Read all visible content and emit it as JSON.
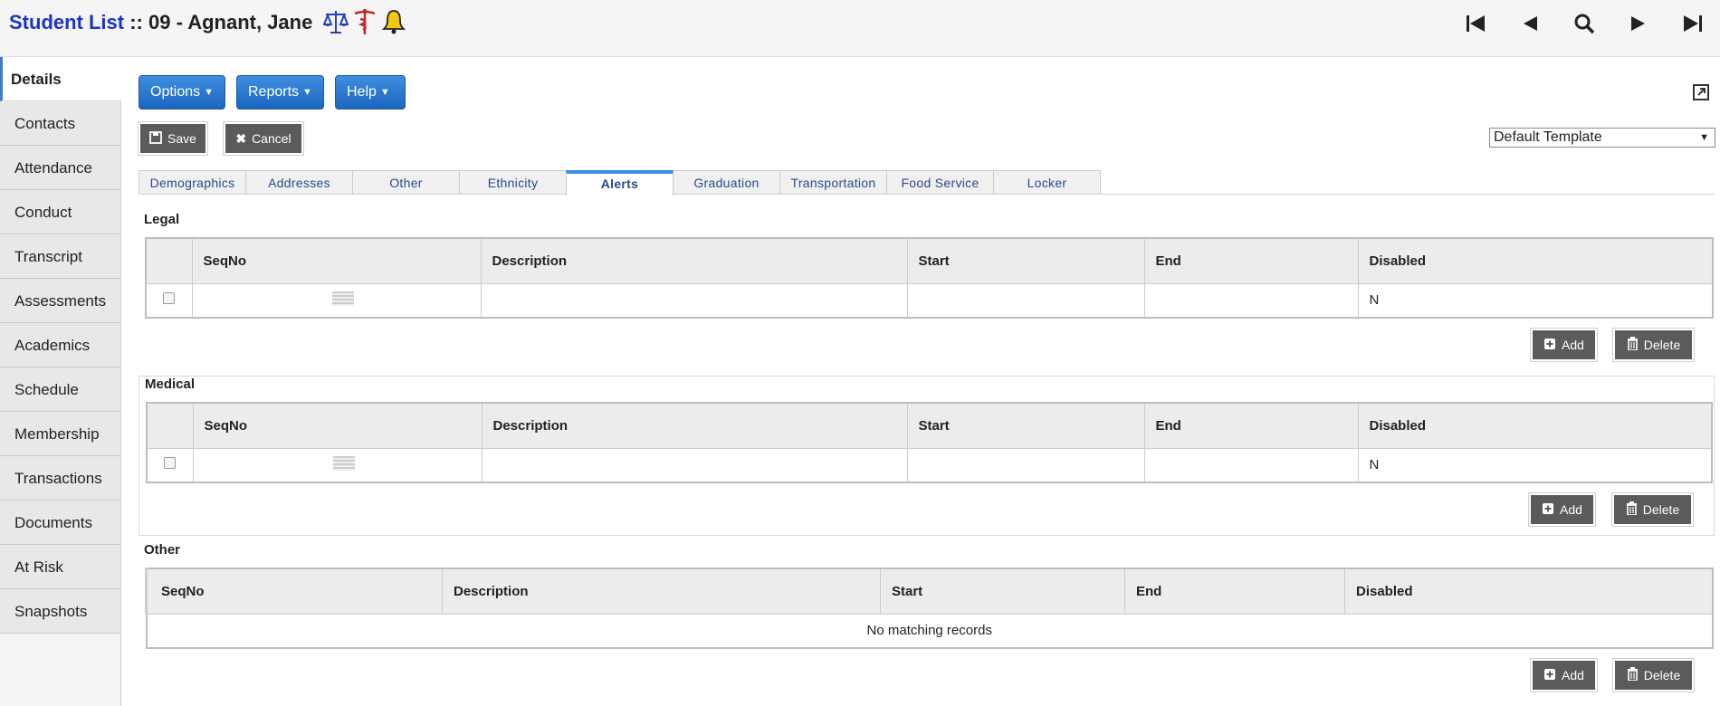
{
  "header": {
    "title_link": "Student List",
    "title_sep": " :: ",
    "title_student": "09 - Agnant, Jane",
    "alert_icons": [
      "legal-scale-icon",
      "medical-caduceus-icon",
      "bell-icon"
    ],
    "nav_icons": [
      "first-record-icon",
      "previous-record-icon",
      "search-icon",
      "next-record-icon",
      "last-record-icon"
    ]
  },
  "sidebar": {
    "items": [
      {
        "label": "Details"
      },
      {
        "label": "Contacts"
      },
      {
        "label": "Attendance"
      },
      {
        "label": "Conduct"
      },
      {
        "label": "Transcript"
      },
      {
        "label": "Assessments"
      },
      {
        "label": "Academics"
      },
      {
        "label": "Schedule"
      },
      {
        "label": "Membership"
      },
      {
        "label": "Transactions"
      },
      {
        "label": "Documents"
      },
      {
        "label": "At Risk"
      },
      {
        "label": "Snapshots"
      }
    ]
  },
  "toolbar": {
    "options_label": "Options",
    "reports_label": "Reports",
    "help_label": "Help",
    "save_label": "Save",
    "cancel_label": "Cancel",
    "template_value": "Default Template"
  },
  "tabs": [
    {
      "label": "Demographics"
    },
    {
      "label": "Addresses"
    },
    {
      "label": "Other"
    },
    {
      "label": "Ethnicity"
    },
    {
      "label": "Alerts"
    },
    {
      "label": "Graduation"
    },
    {
      "label": "Transportation"
    },
    {
      "label": "Food Service"
    },
    {
      "label": "Locker"
    }
  ],
  "legal": {
    "title": "Legal",
    "columns": [
      "SeqNo",
      "Description",
      "Start",
      "End",
      "Disabled"
    ],
    "row": {
      "seqno": "",
      "description": "",
      "start": "",
      "end": "",
      "disabled": "N"
    }
  },
  "medical": {
    "title": "Medical",
    "columns": [
      "SeqNo",
      "Description",
      "Start",
      "End",
      "Disabled"
    ],
    "row": {
      "seqno": "",
      "description": "",
      "start": "",
      "end": "",
      "disabled": "N"
    }
  },
  "other": {
    "title": "Other",
    "columns": [
      "SeqNo",
      "Description",
      "Start",
      "End",
      "Disabled"
    ],
    "empty_text": "No matching records"
  },
  "actions": {
    "add_label": "Add",
    "delete_label": "Delete"
  },
  "colors": {
    "accent": "#1a35c4",
    "button_blue": "#2a78d0",
    "button_gray": "#5b5b5b"
  }
}
